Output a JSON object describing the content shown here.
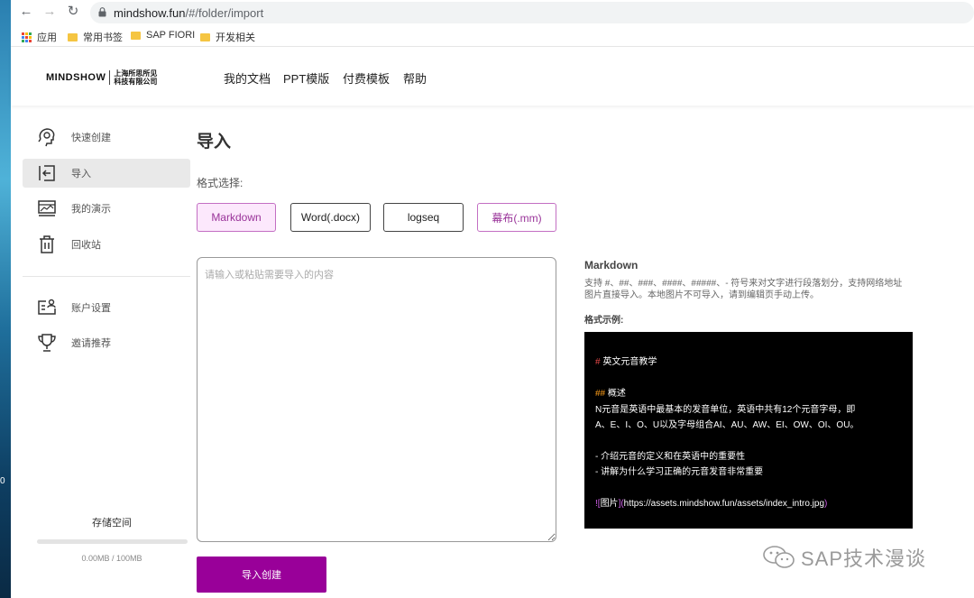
{
  "desktop": {
    "side_number": "0"
  },
  "browser": {
    "url_host": "mindshow.fun",
    "url_path": "/#/folder/import",
    "bookmarks": [
      {
        "label": "应用",
        "icon": "apps-grid-icon"
      },
      {
        "label": "常用书签",
        "icon": "folder-icon"
      },
      {
        "label": "SAP FIORI",
        "icon": "folder-icon"
      },
      {
        "label": "开发相关",
        "icon": "folder-icon"
      }
    ]
  },
  "header": {
    "logo_text": "MINDSHOW",
    "logo_cn_line1": "上海所思所见",
    "logo_cn_line2": "科技有限公司",
    "nav": [
      "我的文档",
      "PPT模版",
      "付费模板",
      "帮助"
    ]
  },
  "sidebar": {
    "items": [
      {
        "label": "快速创建",
        "icon": "brain-icon",
        "active": false
      },
      {
        "label": "导入",
        "icon": "import-icon",
        "active": true
      },
      {
        "label": "我的演示",
        "icon": "presentation-icon",
        "active": false
      },
      {
        "label": "回收站",
        "icon": "trash-icon",
        "active": false
      },
      {
        "label": "账户设置",
        "icon": "account-icon",
        "active": false
      },
      {
        "label": "邀请推荐",
        "icon": "trophy-icon",
        "active": false
      }
    ],
    "storage_title": "存储空间",
    "storage_value": "0.00MB / 100MB",
    "storage_used_fraction": 0
  },
  "main": {
    "title": "导入",
    "format_label": "格式选择:",
    "formats": [
      "Markdown",
      "Word(.docx)",
      "logseq",
      "幕布(.mm)"
    ],
    "selected_format": "Markdown",
    "input_placeholder": "请输入或粘贴需要导入的内容",
    "input_value": "",
    "import_button": "导入创建"
  },
  "info": {
    "title": "Markdown",
    "description": "支持 #、##、###、####、#####、- 符号来对文字进行段落划分，支持网络地址图片直接导入。本地图片不可导入，请到编辑页手动上传。",
    "example_label": "格式示例:",
    "example": {
      "h1_marker": "#",
      "h1_text": " 英文元音教学",
      "h2_marker": "##",
      "h2_text": " 概述",
      "para_line1": " N元音是英语中最基本的发音单位，英语中共有12个元音字母，即",
      "para_line2": " A、E、I、O、U以及字母组合AI、AU、AW、EI、OW、OI、OU。",
      "bullet1": "- 介绍元音的定义和在英语中的重要性",
      "bullet2": "- 讲解为什么学习正确的元音发音非常重要",
      "img_open": "![",
      "img_alt": "图片",
      "img_mid": "](",
      "img_url": "https://assets.mindshow.fun/assets/index_intro.jpg",
      "img_close": ")"
    }
  },
  "watermark": {
    "text": "SAP技术漫谈",
    "icon": "wechat-icon"
  },
  "colors": {
    "accent": "#990099",
    "accent_light": "#fce8fc",
    "code_bg": "#000000"
  }
}
